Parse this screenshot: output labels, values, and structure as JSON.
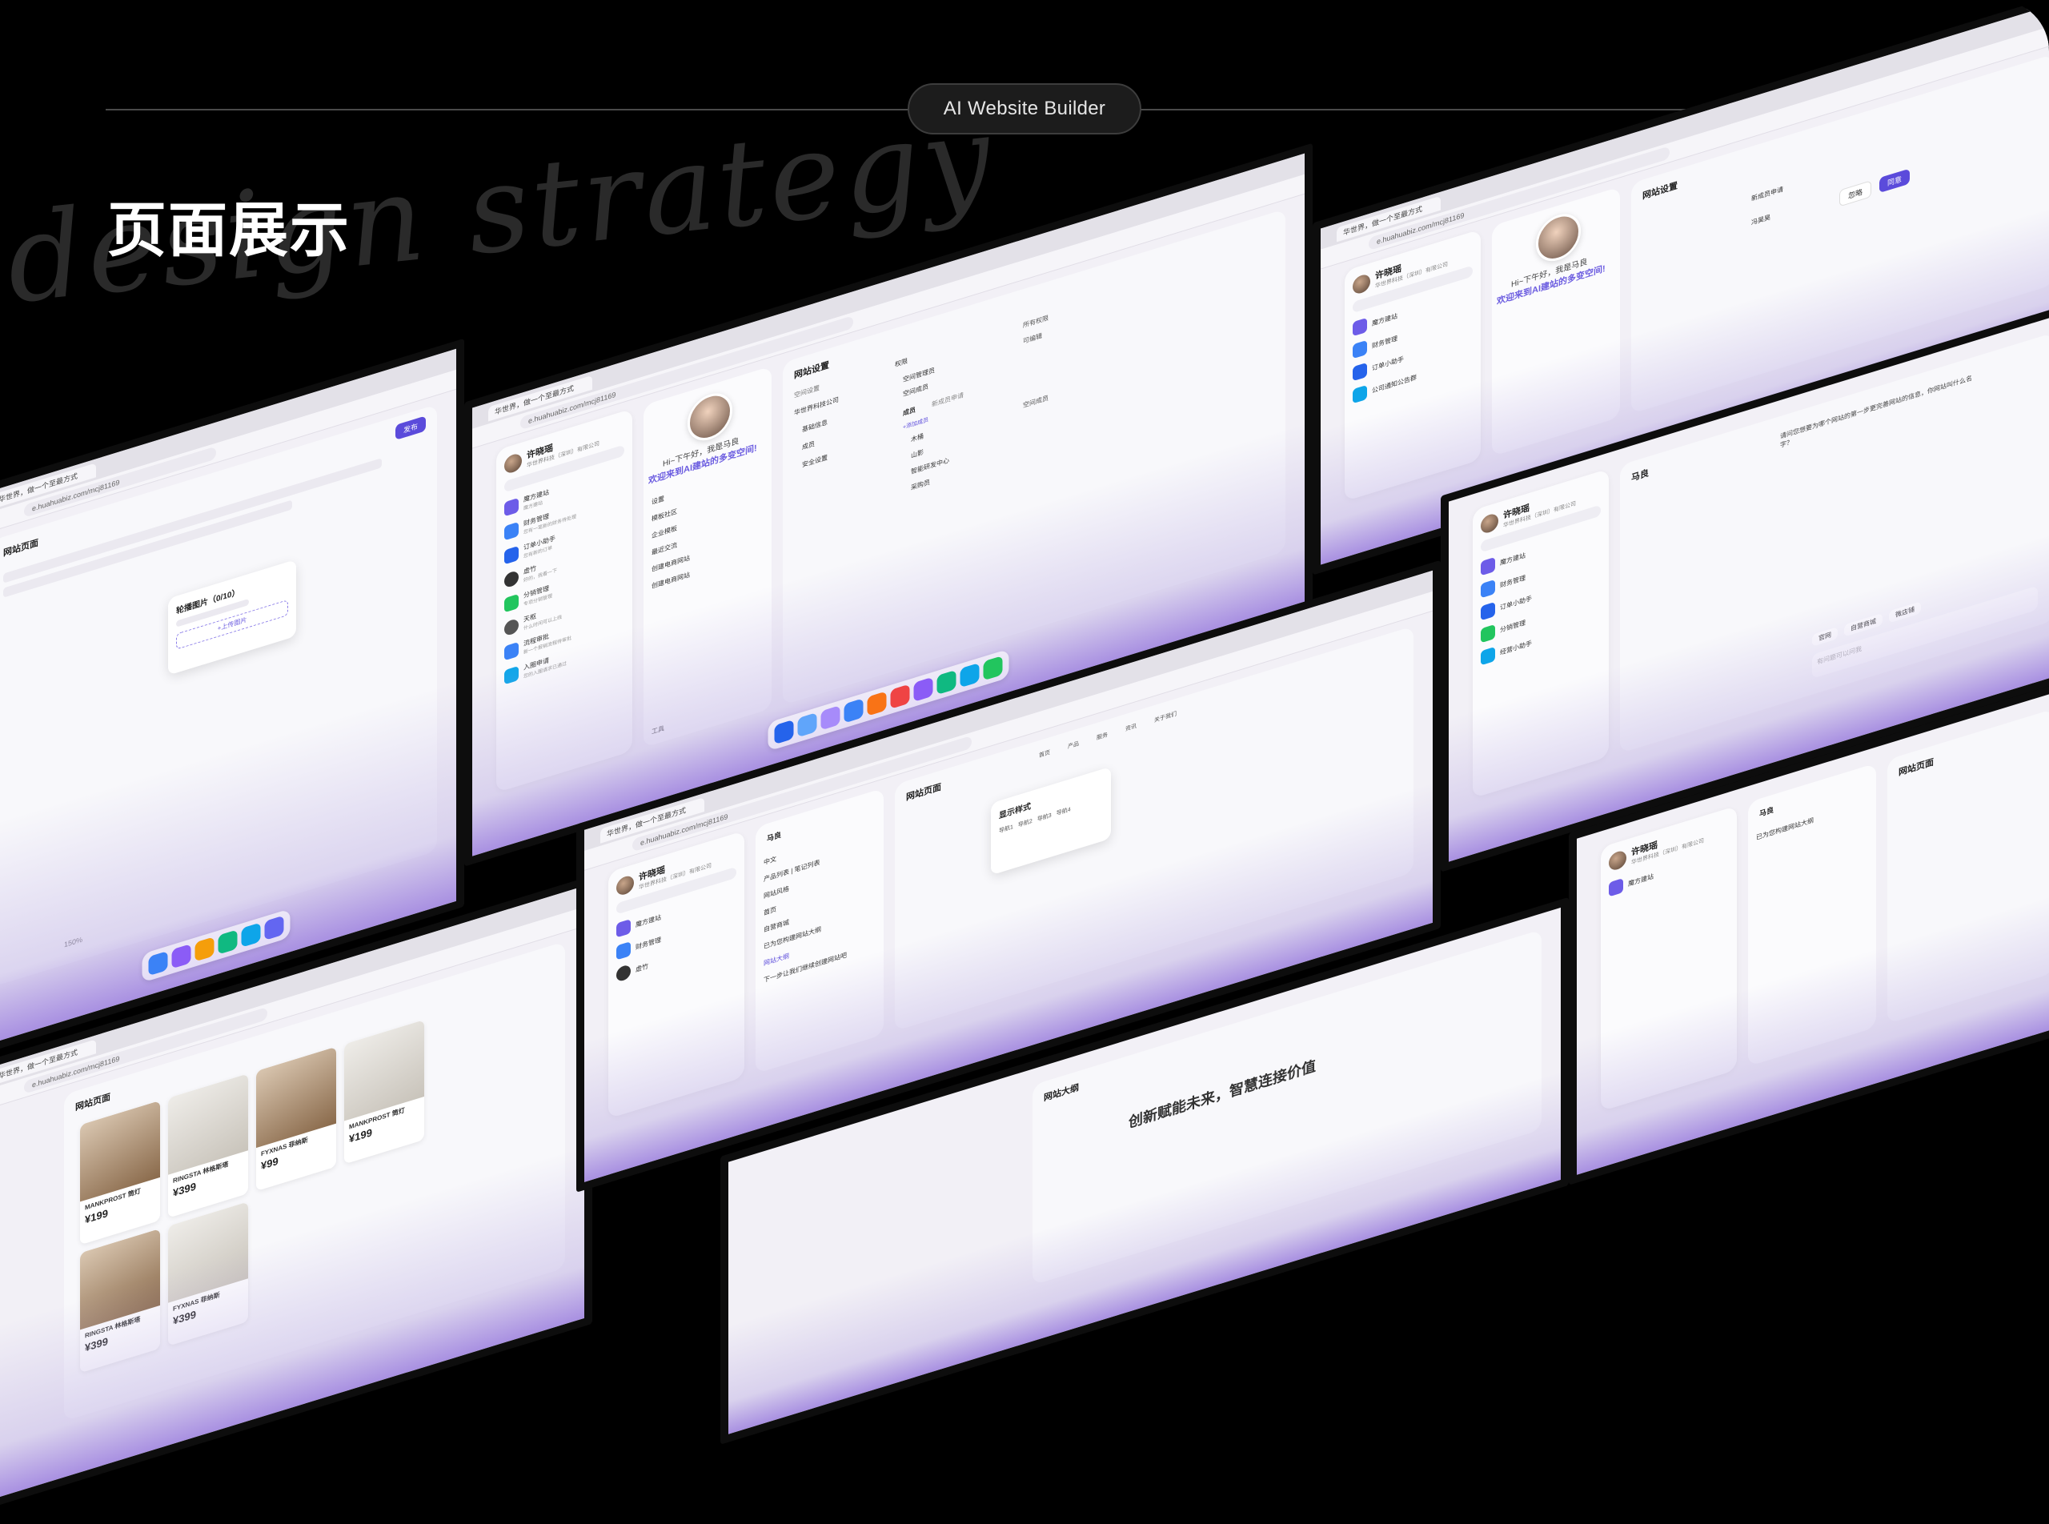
{
  "header": {
    "badge_label": "AI Website Builder",
    "page_title": "页面展示",
    "watermark_script": "design strategy"
  },
  "browser": {
    "tab_title": "华世界，做一个至最方式",
    "address": "e.huahuabiz.com/mcj81169"
  },
  "user": {
    "name": "许晓瑶",
    "org": "华世界科技（深圳）有限公司"
  },
  "chat_items": [
    {
      "label": "魔方建站",
      "sub": "魔方建站"
    },
    {
      "label": "财务管理",
      "sub": "您有一笔新的财务待处理"
    },
    {
      "label": "订单小助手",
      "sub": "您有新的订单"
    },
    {
      "label": "虚竹",
      "sub": "好的，我看一下"
    },
    {
      "label": "分销管理",
      "sub": "专项分销管理"
    },
    {
      "label": "天枢",
      "sub": "什么时间可以上线"
    },
    {
      "label": "流程审批",
      "sub": "新一个报销流程待审批"
    },
    {
      "label": "入圈申请",
      "sub": "您的入圈请求已通过"
    },
    {
      "label": "经营小助手",
      "sub": "经营数据"
    },
    {
      "label": "公司通知公告群",
      "sub": "关于国庆放假通知"
    }
  ],
  "greeting": {
    "hello": "Hi~下午好，我是马良",
    "welcome": "欢迎来到AI建站的多变空间!"
  },
  "assistant_menu": [
    "设置",
    "模板社区",
    "企业模板",
    "最近交流",
    "创建电商网站",
    "创建电商网站"
  ],
  "tools_label": "工具",
  "settings": {
    "title": "网站设置",
    "back": "空间设置",
    "company": "华世界科技公司",
    "nav": [
      "基础信息",
      "成员",
      "安全设置"
    ],
    "perm_header": "权限",
    "perm_value": "所有权限",
    "roles": [
      "空间管理员",
      "空间成员"
    ],
    "tabs": [
      "成员",
      "新成员申请"
    ],
    "add_member": "+添加成员",
    "editable": "可编辑",
    "members": [
      "木桶",
      "山影",
      "智能研发中心",
      "采购员"
    ],
    "member_role": "空间成员",
    "reject": "忽略",
    "agree": "同意",
    "applicant": "冯昊昊"
  },
  "upload_card": {
    "title": "轮播图片（0/10）",
    "button": "+上传图片"
  },
  "editor": {
    "publish": "发布",
    "zoom": "150%",
    "page_title": "网站页面",
    "nav_items": [
      "首页",
      "产品",
      "服务",
      "资讯",
      "关于我们"
    ],
    "style_title": "显示样式",
    "style_tabs": [
      "导航1",
      "导航2",
      "导航3",
      "导航4"
    ],
    "question": "请问您想要为哪个网站的第一步更完善网站的信息，你网站叫什么名字？",
    "quick_replies": [
      "官网",
      "自营商城",
      "微店铺"
    ]
  },
  "conversation": {
    "lang": "中文",
    "items": [
      "产品列表 | 笔记列表",
      "网站风格",
      "首页"
    ],
    "reply": "自营商城",
    "done": "已为您构建网站大纲",
    "outline_link": "网站大纲",
    "next": "下一步让我们继续创建网站吧",
    "input_placeholder": "有问题可以问我"
  },
  "products": [
    {
      "name": "MANKPROST 筒灯",
      "price": "¥199"
    },
    {
      "name": "RINGSTA 林格斯塔",
      "price": "¥399"
    },
    {
      "name": "FYXNAS 菲纳斯",
      "price": "¥99"
    },
    {
      "name": "MANKPROST 筒灯",
      "price": "¥199"
    },
    {
      "name": "RINGSTA 林格斯塔",
      "price": "¥399"
    },
    {
      "name": "FYXNAS 菲纳斯",
      "price": "¥399"
    }
  ],
  "outline": {
    "title": "网站大纲",
    "hero": "创新赋能未来，智慧连接价值"
  },
  "agent_name": "马良",
  "colors": {
    "accent": "#5b4bdb",
    "background": "#000000"
  }
}
